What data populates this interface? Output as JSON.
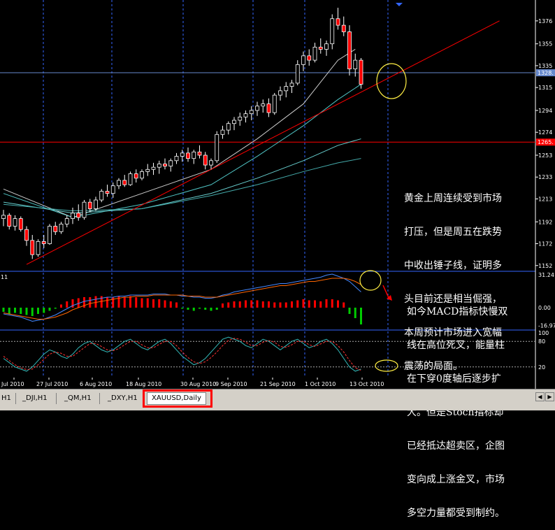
{
  "chart_data": {
    "type": "candlestick",
    "symbol": "XAUUSD",
    "timeframe": "Daily",
    "price_axis": {
      "ylim": [
        1148,
        1390
      ],
      "ticks": [
        1376,
        1355,
        1335,
        1315,
        1294,
        1274,
        1253,
        1233,
        1213,
        1192,
        1172,
        1152
      ],
      "current_price_label": "1328.",
      "hline_label": "1265."
    },
    "candles": [
      [
        1195,
        1203,
        1188,
        1198
      ],
      [
        1198,
        1200,
        1185,
        1188
      ],
      [
        1188,
        1198,
        1184,
        1195
      ],
      [
        1195,
        1197,
        1183,
        1185
      ],
      [
        1185,
        1188,
        1170,
        1175
      ],
      [
        1175,
        1180,
        1158,
        1162
      ],
      [
        1162,
        1176,
        1160,
        1174
      ],
      [
        1174,
        1180,
        1168,
        1172
      ],
      [
        1172,
        1190,
        1171,
        1188
      ],
      [
        1188,
        1192,
        1180,
        1183
      ],
      [
        1183,
        1192,
        1181,
        1190
      ],
      [
        1190,
        1198,
        1187,
        1195
      ],
      [
        1195,
        1205,
        1190,
        1200
      ],
      [
        1200,
        1208,
        1193,
        1196
      ],
      [
        1196,
        1212,
        1194,
        1210
      ],
      [
        1210,
        1213,
        1201,
        1204
      ],
      [
        1204,
        1215,
        1202,
        1212
      ],
      [
        1212,
        1222,
        1210,
        1220
      ],
      [
        1220,
        1226,
        1215,
        1218
      ],
      [
        1218,
        1228,
        1214,
        1225
      ],
      [
        1225,
        1232,
        1222,
        1230
      ],
      [
        1230,
        1235,
        1224,
        1226
      ],
      [
        1226,
        1238,
        1225,
        1236
      ],
      [
        1236,
        1240,
        1228,
        1232
      ],
      [
        1232,
        1240,
        1230,
        1238
      ],
      [
        1238,
        1245,
        1234,
        1240
      ],
      [
        1240,
        1246,
        1235,
        1242
      ],
      [
        1242,
        1248,
        1236,
        1245
      ],
      [
        1245,
        1250,
        1240,
        1243
      ],
      [
        1243,
        1250,
        1238,
        1248
      ],
      [
        1248,
        1255,
        1245,
        1252
      ],
      [
        1252,
        1258,
        1247,
        1255
      ],
      [
        1255,
        1260,
        1247,
        1250
      ],
      [
        1250,
        1258,
        1245,
        1256
      ],
      [
        1256,
        1262,
        1250,
        1253
      ],
      [
        1253,
        1256,
        1240,
        1244
      ],
      [
        1244,
        1250,
        1240,
        1248
      ],
      [
        1248,
        1275,
        1246,
        1272
      ],
      [
        1272,
        1280,
        1268,
        1276
      ],
      [
        1276,
        1284,
        1272,
        1282
      ],
      [
        1282,
        1288,
        1276,
        1285
      ],
      [
        1285,
        1292,
        1280,
        1288
      ],
      [
        1288,
        1294,
        1283,
        1291
      ],
      [
        1291,
        1298,
        1285,
        1294
      ],
      [
        1294,
        1302,
        1289,
        1298
      ],
      [
        1298,
        1304,
        1292,
        1300
      ],
      [
        1300,
        1305,
        1288,
        1292
      ],
      [
        1292,
        1310,
        1290,
        1308
      ],
      [
        1308,
        1316,
        1303,
        1312
      ],
      [
        1312,
        1320,
        1306,
        1316
      ],
      [
        1316,
        1322,
        1310,
        1319
      ],
      [
        1319,
        1340,
        1317,
        1336
      ],
      [
        1336,
        1348,
        1330,
        1344
      ],
      [
        1344,
        1350,
        1335,
        1340
      ],
      [
        1340,
        1356,
        1338,
        1352
      ],
      [
        1352,
        1360,
        1346,
        1350
      ],
      [
        1350,
        1358,
        1344,
        1355
      ],
      [
        1355,
        1382,
        1350,
        1378
      ],
      [
        1378,
        1388,
        1368,
        1372
      ],
      [
        1372,
        1380,
        1362,
        1366
      ],
      [
        1366,
        1372,
        1326,
        1332
      ],
      [
        1332,
        1346,
        1325,
        1340
      ],
      [
        1340,
        1342,
        1314,
        1318
      ]
    ],
    "moving_averages": [
      {
        "color": "#cccccc",
        "points": [
          [
            0,
            1222
          ],
          [
            12,
            1196
          ],
          [
            24,
            1218
          ],
          [
            36,
            1240
          ],
          [
            44,
            1268
          ],
          [
            52,
            1300
          ],
          [
            58,
            1340
          ],
          [
            61,
            1350
          ]
        ]
      },
      {
        "color": "#4fc3c3",
        "points": [
          [
            0,
            1218
          ],
          [
            12,
            1196
          ],
          [
            24,
            1208
          ],
          [
            36,
            1226
          ],
          [
            44,
            1252
          ],
          [
            52,
            1280
          ],
          [
            58,
            1304
          ],
          [
            62,
            1318
          ]
        ]
      },
      {
        "color": "#66cccc",
        "points": [
          [
            0,
            1210
          ],
          [
            12,
            1200
          ],
          [
            24,
            1204
          ],
          [
            36,
            1218
          ],
          [
            44,
            1232
          ],
          [
            52,
            1248
          ],
          [
            58,
            1262
          ],
          [
            62,
            1268
          ]
        ]
      },
      {
        "color": "#44aaaa",
        "points": [
          [
            0,
            1208
          ],
          [
            12,
            1202
          ],
          [
            24,
            1204
          ],
          [
            36,
            1216
          ],
          [
            44,
            1226
          ],
          [
            52,
            1238
          ],
          [
            58,
            1246
          ],
          [
            62,
            1250
          ]
        ]
      }
    ],
    "trendline": {
      "color": "#ff0000",
      "points": [
        [
          4,
          1153
        ],
        [
          62,
          1318
        ],
        [
          86,
          1376
        ]
      ]
    },
    "macd": {
      "yticks": [
        "31.24",
        "0.00",
        "-16.97"
      ],
      "ylim": [
        -20,
        34
      ],
      "label": "11",
      "histogram": [
        -4,
        -6,
        -5,
        -6,
        -7,
        -8,
        -6,
        -5,
        -3,
        -1,
        3,
        6,
        8,
        9,
        10,
        10,
        11,
        11,
        10,
        10,
        11,
        10,
        11,
        10,
        9,
        9,
        8,
        8,
        7,
        6,
        5,
        -1,
        -2,
        -3,
        -1,
        -2,
        -3,
        -2,
        4,
        5,
        6,
        6,
        7,
        7,
        7,
        6,
        6,
        5,
        5,
        5,
        6,
        7,
        8,
        7,
        7,
        6,
        8,
        8,
        7,
        5,
        -6,
        -10,
        -16
      ],
      "line_fast": [
        -6,
        -7,
        -8,
        -9,
        -11,
        -13,
        -12,
        -11,
        -9,
        -7,
        -4,
        -1,
        2,
        4,
        6,
        7,
        8,
        9,
        10,
        10,
        11,
        11,
        12,
        12,
        12,
        12,
        13,
        13,
        13,
        12,
        12,
        11,
        11,
        10,
        10,
        9,
        9,
        10,
        12,
        13,
        15,
        16,
        17,
        18,
        19,
        20,
        21,
        22,
        23,
        23,
        24,
        25,
        26,
        27,
        28,
        29,
        31,
        32,
        30,
        28,
        25,
        20,
        15
      ],
      "line_slow": [
        -5,
        -6,
        -7,
        -8,
        -9,
        -10,
        -11,
        -11,
        -10,
        -9,
        -7,
        -5,
        -2,
        0,
        2,
        4,
        5,
        6,
        7,
        8,
        9,
        10,
        10,
        11,
        11,
        11,
        12,
        12,
        12,
        12,
        12,
        12,
        11,
        11,
        11,
        10,
        10,
        10,
        11,
        12,
        13,
        14,
        15,
        16,
        17,
        18,
        19,
        20,
        21,
        21,
        22,
        23,
        24,
        25,
        25,
        26,
        27,
        28,
        28,
        28,
        27,
        25,
        22
      ]
    },
    "stoch": {
      "yticks": [
        "100",
        "80",
        "20"
      ],
      "levels": [
        80,
        20
      ],
      "k": [
        40,
        30,
        20,
        15,
        10,
        20,
        35,
        50,
        60,
        55,
        45,
        40,
        50,
        65,
        75,
        80,
        70,
        60,
        55,
        60,
        70,
        80,
        85,
        75,
        65,
        60,
        70,
        80,
        85,
        75,
        60,
        45,
        35,
        25,
        30,
        40,
        55,
        70,
        85,
        90,
        85,
        80,
        70,
        65,
        75,
        85,
        80,
        70,
        60,
        70,
        80,
        85,
        75,
        65,
        70,
        80,
        85,
        75,
        60,
        40,
        20,
        10,
        15
      ],
      "d": [
        45,
        35,
        25,
        18,
        14,
        15,
        25,
        38,
        50,
        55,
        52,
        45,
        45,
        55,
        65,
        75,
        75,
        68,
        60,
        58,
        63,
        72,
        80,
        80,
        72,
        65,
        65,
        73,
        80,
        80,
        70,
        55,
        42,
        32,
        28,
        32,
        42,
        55,
        70,
        82,
        87,
        85,
        78,
        70,
        70,
        78,
        82,
        78,
        68,
        66,
        72,
        80,
        80,
        72,
        68,
        74,
        80,
        80,
        70,
        55,
        35,
        18,
        12
      ]
    },
    "x_axis_labels": [
      "Jul 2010",
      "27 Jul 2010",
      "6 Aug 2010",
      "18 Aug 2010",
      "30 Aug 2010",
      "9 Sep 2010",
      "21 Sep 2010",
      "1 Oct 2010",
      "13 Oct 2010"
    ]
  },
  "annotations": {
    "main": [
      "黄金上周连续受到市场",
      "打压，但是周五在跌势",
      "中收出锤子线，证明多",
      "头目前还是相当倔强，",
      "本周预计市场进入宽幅",
      "震荡的局面。"
    ],
    "macd": [
      "如今MACD指标快慢双",
      "线在高位死叉，能量柱",
      "在下穿0度轴后逐步扩",
      "大。但是Stoch指标却",
      "已经抵达超卖区，企图",
      "变向成上涨金叉，市场",
      "多空力量都受到制约。"
    ]
  },
  "tabs": [
    "H1",
    "_DJI,H1",
    "_QM,H1",
    "_DXY,H1",
    "XAUUSD,Daily"
  ],
  "colors": {
    "background": "#000000",
    "bull_candle": "#ffffff",
    "bear_candle": "#ff0000",
    "macd_pos": "#ff0000",
    "macd_neg": "#00cc00",
    "macd_fast": "#4488ff",
    "macd_slow": "#ff6600",
    "stoch_k": "#33bbbb",
    "stoch_d": "#ff3333",
    "grid": "#3366ff",
    "accent": "#ff0000"
  }
}
